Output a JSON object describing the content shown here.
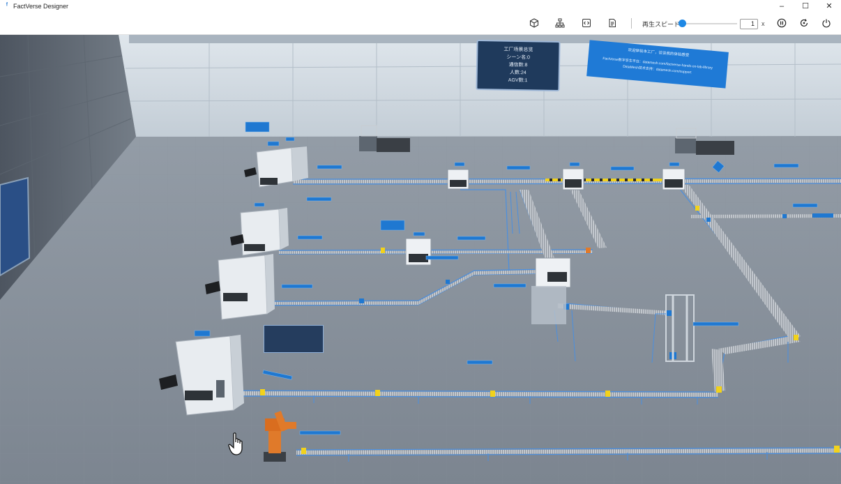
{
  "window": {
    "title": "FactVerse Designer",
    "controls": [
      "–",
      "☐",
      "✕"
    ]
  },
  "toolbar": {
    "icons": [
      "cube-icon",
      "hierarchy-icon",
      "code-icon",
      "document-icon"
    ],
    "speed_label": "再生スピード",
    "speed_value": "1",
    "speed_unit": "x",
    "speed_slider_fraction": 0.0,
    "playback_icons": [
      "pause-icon",
      "reset-icon",
      "power-icon"
    ]
  },
  "scene": {
    "summary_panel": {
      "lines": [
        "工厂场景总览",
        "シーン名:0",
        "通信数:8",
        "人数:24",
        "AGV数:1"
      ]
    },
    "welcome_panel": {
      "title": "欢迎体验本工厂，谈谈我的体验感受",
      "lines": [
        "FactVerse数字孪生平台：datamesh.com/factverse-hands-on-lab-library",
        "DataMesh技术支持：datamesh.com/support"
      ]
    },
    "colors": {
      "wall": "#c9d3dc",
      "floor": "#8a939d",
      "conveyor_rail": "#4a8fe0",
      "machine_body": "#e9edf1",
      "robot_arm": "#e07a2a",
      "tag_blue": "#1f78d1"
    }
  }
}
